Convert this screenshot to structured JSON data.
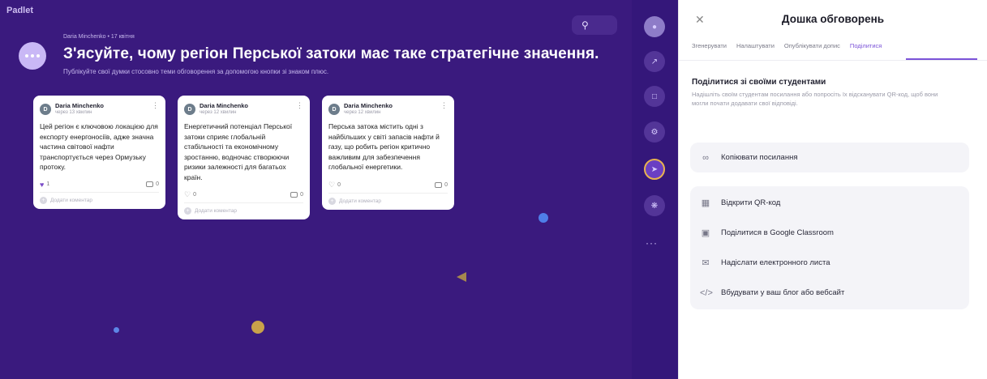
{
  "board": {
    "logo": "Padlet",
    "search_icon": "search-icon",
    "author_line": "Daria Minchenko • 17 квітня",
    "title": "З'ясуйте, чому регіон Перської затоки має таке стратегічне значення.",
    "subtitle": "Публікуйте свої думки стосовно теми обговорення за допомогою кнопки зі знаком плюс."
  },
  "posts": [
    {
      "author": "Daria Minchenko",
      "date": "через 13 хвилин",
      "body": "Цей регіон є ключовою локацією для експорту енергоносіїв, адже значна частина світової нафти транспортується через Ормузьку протоку.",
      "likes": "1",
      "comments": "0",
      "add_comment": "Додати коментар"
    },
    {
      "author": "Daria Minchenko",
      "date": "через 12 хвилин",
      "body": "Енергетичний потенціал Перської затоки сприяє глобальній стабільності та економічному зростанню, водночас створюючи ризики залежності для багатьох країн.",
      "likes": "0",
      "comments": "0",
      "add_comment": "Додати коментар"
    },
    {
      "author": "Daria Minchenko",
      "date": "через 12 хвилин",
      "body": "Перська затока містить одні з найбільших у світі запасів нафти й газу, що робить регіон критично важливим для забезпечення глобальної енергетики.",
      "likes": "0",
      "comments": "0",
      "add_comment": "Додати коментар"
    }
  ],
  "toolbar": {
    "items": [
      "avatar",
      "activity-icon",
      "copy-icon",
      "settings-icon",
      "share-icon",
      "gear-icon"
    ],
    "more": "···"
  },
  "panel": {
    "title": "Дошка обговорень",
    "tabs": [
      "Згенерувати",
      "Налаштувати",
      "Опублікувати допис",
      "Поділитися"
    ],
    "share_title": "Поділитися зі своїми студентами",
    "share_desc": "Надішліть своїм студентам посилання або попросіть їх відсканувати QR-код, щоб вони могли почати додавати свої відповіді.",
    "copy_link": "Копіювати посилання",
    "options": [
      {
        "icon": "qr-icon",
        "label": "Відкрити QR-код"
      },
      {
        "icon": "classroom-icon",
        "label": "Поділитися в Google Classroom"
      },
      {
        "icon": "mail-icon",
        "label": "Надіслати електронного листа"
      },
      {
        "icon": "code-icon",
        "label": "Вбудувати у ваш блог або вебсайт"
      }
    ]
  },
  "colors": {
    "board_bg": "#3a1a7e",
    "accent": "#7b53d8",
    "active_ring": "#e8b34f"
  }
}
